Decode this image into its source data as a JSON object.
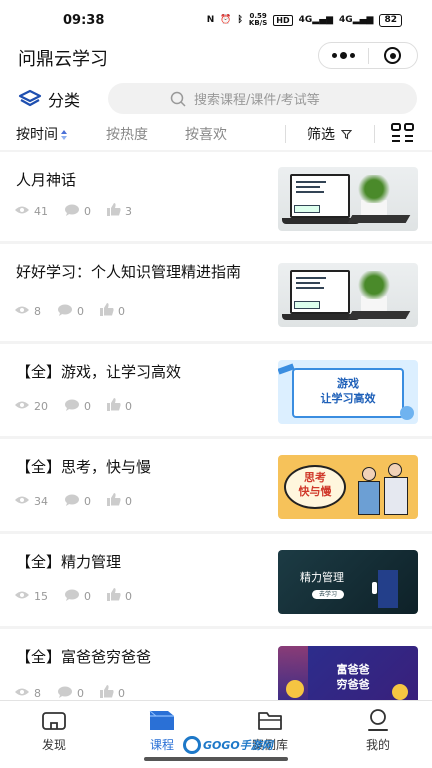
{
  "status_bar": {
    "time": "09:38",
    "net_speed_value": "0.59",
    "net_speed_unit": "KB/S",
    "hd": "HD",
    "signal_1": "4G",
    "signal_2": "4G",
    "battery": "82"
  },
  "header": {
    "title": "问鼎云学习"
  },
  "search": {
    "category_label": "分类",
    "placeholder": "搜索课程/课件/考试等"
  },
  "filters": {
    "sort_options": [
      "按时间",
      "按热度",
      "按喜欢"
    ],
    "active_sort": "按时间",
    "filter_label": "筛选"
  },
  "courses": [
    {
      "title": "人月神话",
      "views": "41",
      "comments": "0",
      "likes": "3",
      "thumb": "laptop-plant"
    },
    {
      "title": "好好学习：个人知识管理精进指南",
      "views": "8",
      "comments": "0",
      "likes": "0",
      "thumb": "laptop-plant"
    },
    {
      "title": "【全】游戏，让学习高效",
      "views": "20",
      "comments": "0",
      "likes": "0",
      "thumb": "game-banner",
      "thumb_text": [
        "游戏",
        "让学习高效"
      ]
    },
    {
      "title": "【全】思考，快与慢",
      "views": "34",
      "comments": "0",
      "likes": "0",
      "thumb": "think-banner",
      "thumb_text": [
        "思考",
        "快与慢"
      ]
    },
    {
      "title": "【全】精力管理",
      "views": "15",
      "comments": "0",
      "likes": "0",
      "thumb": "energy-banner",
      "thumb_text": [
        "精力管理",
        "去学习"
      ]
    },
    {
      "title": "【全】富爸爸穷爸爸",
      "views": "8",
      "comments": "0",
      "likes": "0",
      "thumb": "rich-banner",
      "thumb_text": [
        "富爸爸",
        "穷爸爸"
      ]
    }
  ],
  "tabs": [
    {
      "label": "发现",
      "icon": "home-icon"
    },
    {
      "label": "课程",
      "icon": "course-icon"
    },
    {
      "label": "案例库",
      "icon": "folder-icon"
    },
    {
      "label": "我的",
      "icon": "profile-icon"
    }
  ],
  "active_tab": "课程",
  "watermark": "GOGO手游网",
  "colors": {
    "accent": "#2a70d6",
    "background": "#f3f3f3"
  }
}
